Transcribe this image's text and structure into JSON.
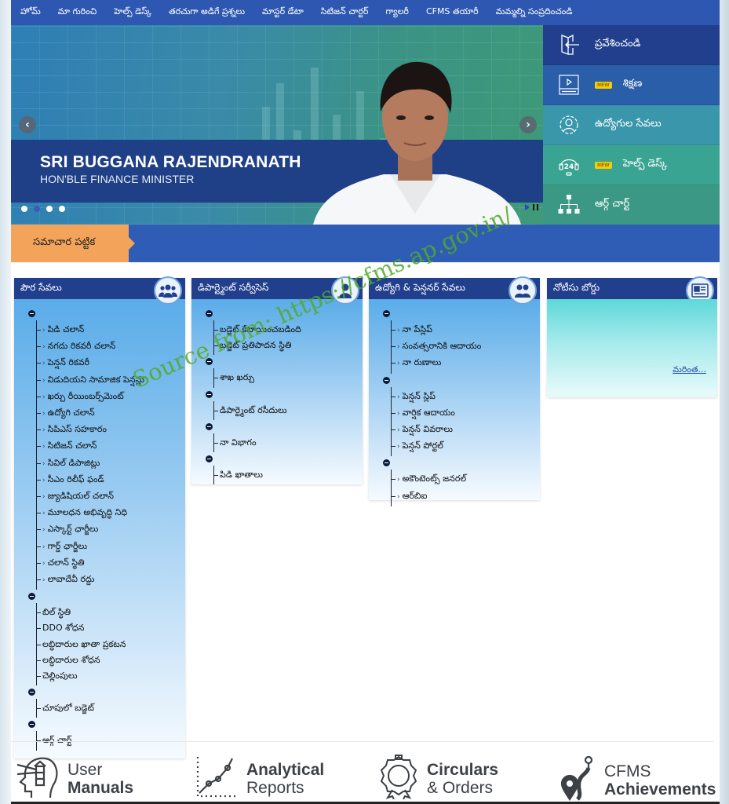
{
  "nav": {
    "items": [
      "హోమ్",
      "మా గురించి",
      "హెల్ప్ డెస్క్",
      "తరచుగా అడిగే ప్రశ్నలు",
      "మాస్టర్ డేటా",
      "సిటిజన్ చార్టర్",
      "గ్యాలరీ",
      "CFMS తయారీ",
      "మమ్మల్ని సంప్రదించండి"
    ]
  },
  "banner": {
    "name": "SRI BUGGANA RAJENDRANATH",
    "role": "HON'BLE FINANCE MINISTER",
    "prev_icon": "chevron-left-icon",
    "next_icon": "chevron-right-icon",
    "prev_glyph": "‹",
    "next_glyph": "›",
    "slide_count": 4,
    "active_slide": 2
  },
  "quick_menu": [
    {
      "label": "ప్రవేశించండి",
      "icon": "login-door-icon",
      "new": false,
      "color": "#213f8d"
    },
    {
      "label": "శిక్షణ",
      "icon": "video-training-icon",
      "new": true,
      "color": "#2a5ea8"
    },
    {
      "label": "ఉద్యోగుల సేవలు",
      "icon": "employee-gear-icon",
      "new": false,
      "color": "#3a97ab"
    },
    {
      "label": "హెల్ప్ డెస్క్",
      "icon": "helpdesk-24-icon",
      "new": true,
      "color": "#3aa493"
    },
    {
      "label": "ఆర్గ్ చార్ట్",
      "icon": "org-chart-icon",
      "new": false,
      "color": "#3a9885"
    }
  ],
  "new_badge": "NEW",
  "news": {
    "label": "సమాచార పట్టిక"
  },
  "panels": {
    "citizen": {
      "title": "పౌర సేవలు",
      "icon": "group-users-icon",
      "groups": [
        {
          "items": [
            "పిడి చలాన్",
            "నగదు రికవరీ చలాన్",
            "పెన్షన్ రికవరీ",
            "విడుదియని సామాజిక పెన్షన్లు",
            "ఖర్చు రీయింబర్స్‌మెంట్",
            "ఉద్యోగి చలాన్",
            "సిపిఎస్ సహకారం",
            "సిటిజన్ చలాన్",
            "సివిల్ డిపాజిట్లు",
            "సీఎం రిలీఫ్ ఫండ్",
            "జ్యుడిషియల్ చలాన్",
            "మూలధన అభివృద్ధి నిధి",
            "ఎస్కార్ట్ ఛార్జీలు",
            "గార్డ్ ఛార్జీలు",
            "చలాన్ స్థితి",
            "లావాదేవీ రద్దు"
          ],
          "chevron": true
        },
        {
          "items": [
            "బిల్ స్థితి",
            "DDO శోధన",
            "లబ్ధిదారుల ఖాతా ప్రకటన",
            "లబ్ధిదారుల శోధన",
            "చెల్లింపులు"
          ],
          "chevron": false
        },
        {
          "items": [
            "చూపులో బడ్జెట్"
          ],
          "chevron": false
        },
        {
          "items": [
            "ఆర్గ్ చార్ట్"
          ],
          "chevron": false
        }
      ]
    },
    "department": {
      "title": "డిపార్ట్మెంట్ సర్వీసెస్",
      "icon": "user-icon",
      "groups": [
        {
          "items": [
            "బడ్జెట్ కేటాయించబడింది",
            "బడ్జెట్ ప్రతిపాదన స్థితి"
          ],
          "chevron": false
        },
        {
          "items": [
            "శాఖ ఖర్చు"
          ],
          "chevron": false
        },
        {
          "items": [
            "డిపార్ట్మెంట్ రసీదులు"
          ],
          "chevron": false
        },
        {
          "items": [
            "నా విభాగం"
          ],
          "chevron": false
        },
        {
          "items": [
            "పిడి ఖాతాలు"
          ],
          "chevron": false
        }
      ]
    },
    "employee": {
      "title": "ఉద్యోగి & పెన్షనర్ సేవలు",
      "icon": "employee-pensioner-icon",
      "groups": [
        {
          "items": [
            "నా పేస్లిప్",
            "సంవత్సరానికి ఆదాయం",
            "నా రుణాలు"
          ],
          "chevron": true
        },
        {
          "items": [
            "పెన్షన్ స్లిప్",
            "వార్షిక ఆదాయం",
            "పెన్షన్ వివరాలు",
            "పెన్షన్ పోర్టల్"
          ],
          "chevron": true
        },
        {
          "items": [
            "అకౌంటెంట్స్ జనరల్",
            "ఆర్‌బిఐ"
          ],
          "chevron": true
        }
      ]
    },
    "notice": {
      "title": "నోటీసు బోర్డు",
      "icon": "newspaper-icon",
      "more": "మరింత..."
    }
  },
  "watermark": "Source from: https://cfms.ap.gov.in/",
  "footer_links": [
    {
      "line1": "User",
      "line2": "Manuals",
      "bold": 2,
      "icon": "head-lighthouse-icon"
    },
    {
      "line1": "Analytical",
      "line2": "Reports",
      "bold": 1,
      "icon": "trend-chart-icon"
    },
    {
      "line1": "Circulars",
      "line2": "& Orders",
      "bold": 1,
      "icon": "badge-seal-icon"
    },
    {
      "line1": "CFMS",
      "line2": "Achievements",
      "bold": 2,
      "icon": "location-route-icon"
    }
  ]
}
